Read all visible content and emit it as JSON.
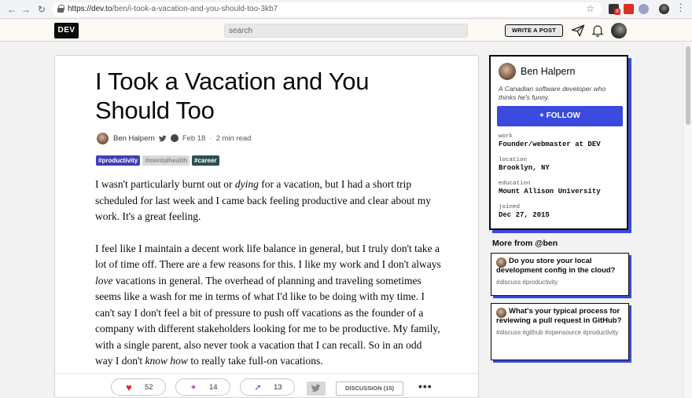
{
  "browser": {
    "url_host": "https://dev.to",
    "url_path": "/ben/i-took-a-vacation-and-you-should-too-3kb7",
    "nav_back": "←",
    "nav_forward": "→",
    "nav_reload": "↻",
    "bookmark_star": "☆",
    "menu": "⋮",
    "extension_badge": "8"
  },
  "header": {
    "logo": "DEV",
    "search_placeholder": "search",
    "write_post": "WRITE A POST"
  },
  "article": {
    "title": "I Took a Vacation and You Should Too",
    "author": "Ben Halpern",
    "date": "Feb 18",
    "separator": "·",
    "read_time": "2 min read",
    "tags": [
      "#productivity",
      "#mentalhealth",
      "#career"
    ],
    "p1_a": "I wasn't particularly burnt out or ",
    "p1_em": "dying",
    "p1_b": " for a vacation, but I had a short trip scheduled for last week and I came back feeling productive and clear about my work. It's a great feeling.",
    "p2_a": "I feel like I maintain a decent work life balance in general, but I truly don't take a lot of time off. There are a few reasons for this. I like my work and I don't always ",
    "p2_em1": "love",
    "p2_b": " vacations in general. The overhead of planning and traveling sometimes seems like a wash for me in terms of what I'd like to be doing with my time. I can't say I don't feel a bit of pressure to push off vacations as the founder of a company with different stakeholders looking for me to be productive. My family, with a single parent, also never took a vacation that I can recall. So in an odd way I don't ",
    "p2_em2": "know how",
    "p2_c": " to really take full-on vacations."
  },
  "reactions": {
    "hearts": "52",
    "unicorns": "14",
    "bookmarks": "13",
    "discussion": "DISCUSSION (15)",
    "more": "•••"
  },
  "profile": {
    "name": "Ben Halpern",
    "bio": "A Canadian software developer who thinks he's funny.",
    "follow": "+ FOLLOW",
    "work_label": "work",
    "work": "Founder/webmaster at DEV",
    "location_label": "location",
    "location": "Brooklyn, NY",
    "education_label": "education",
    "education": "Mount Allison University",
    "joined_label": "joined",
    "joined": "Dec 27, 2015"
  },
  "more_from": {
    "title": "More from @ben",
    "posts": [
      {
        "title": "Do you store your local development config in the cloud?",
        "tags": "#discuss #productivity"
      },
      {
        "title": "What's your typical process for reviewing a pull request in GitHub?",
        "tags": "#discuss #github #opensource #productivity"
      }
    ]
  },
  "colors": {
    "accent": "#3b49df",
    "tag_productivity": "#3f3fb5",
    "tag_career": "#2f4f4f",
    "heart": "#e0243a"
  }
}
